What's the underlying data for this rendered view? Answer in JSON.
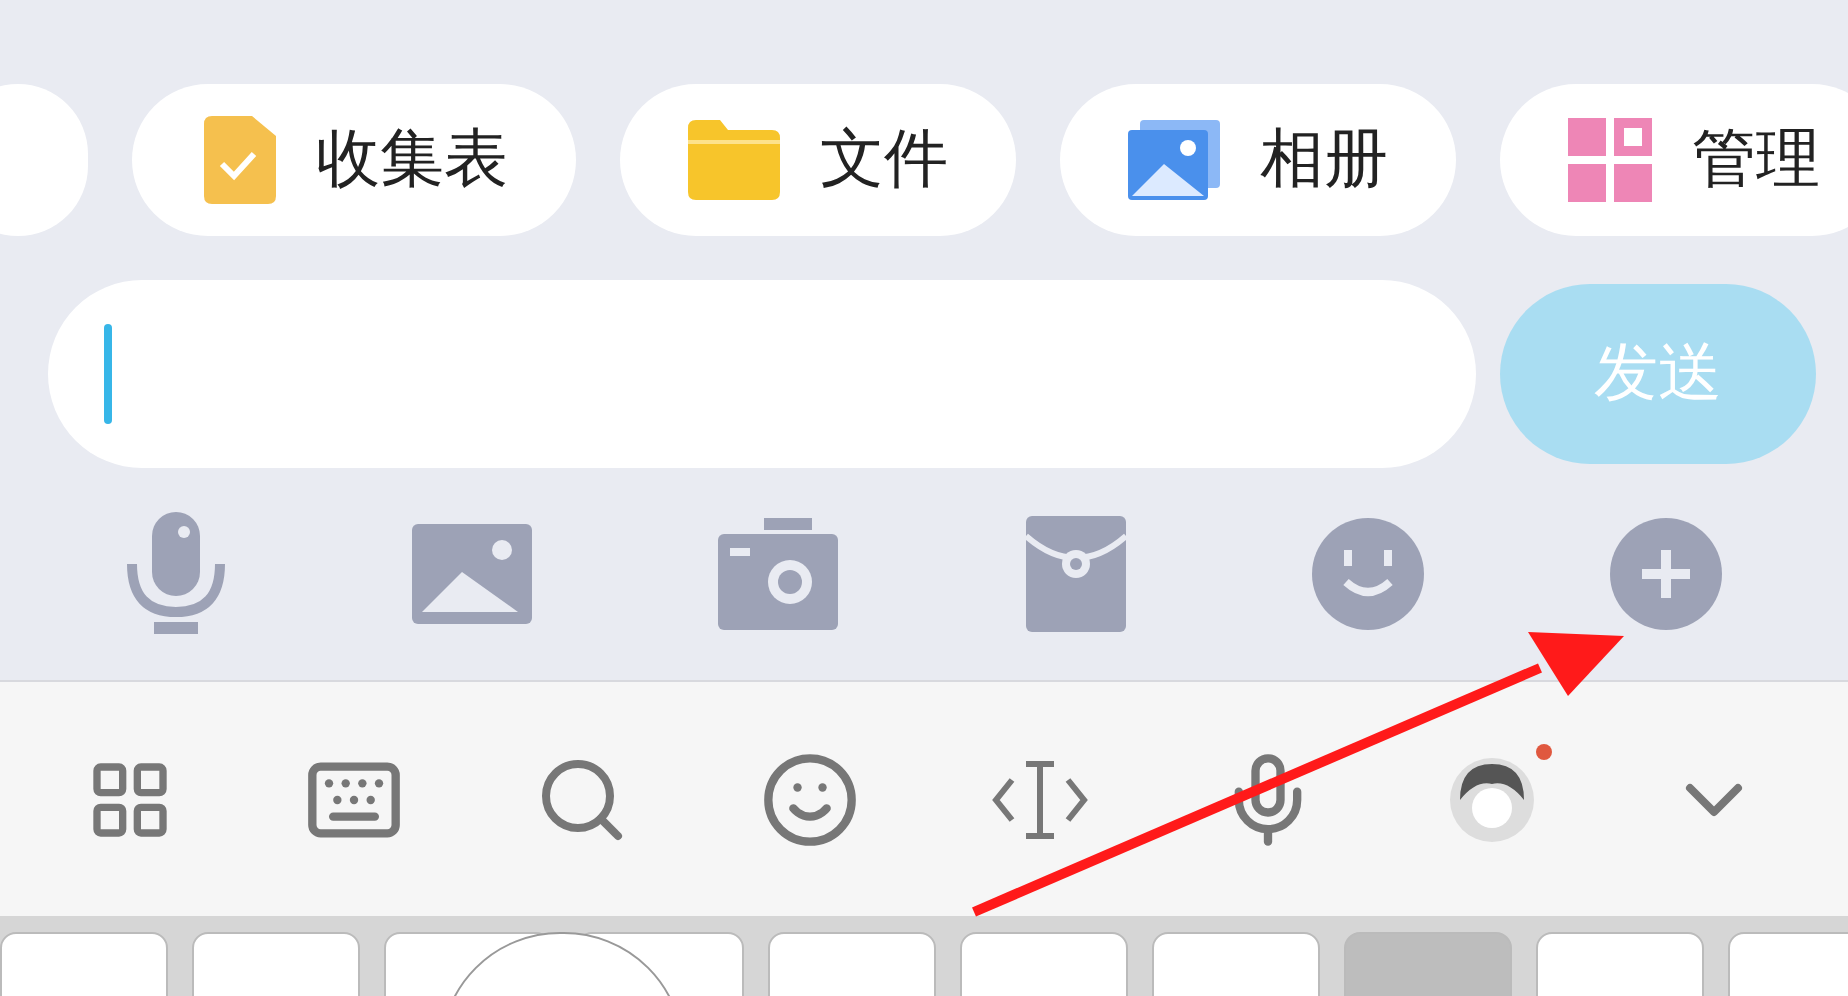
{
  "shortcut_chips": [
    {
      "kind": "form",
      "label": "收集表"
    },
    {
      "kind": "folder",
      "label": "文件"
    },
    {
      "kind": "album",
      "label": "相册"
    },
    {
      "kind": "manage",
      "label": "管理"
    }
  ],
  "message_input": {
    "focused": true
  },
  "send_button": {
    "label": "发送",
    "disabled": true
  },
  "action_icons": [
    {
      "kind": "voice"
    },
    {
      "kind": "image"
    },
    {
      "kind": "camera"
    },
    {
      "kind": "red-packet"
    },
    {
      "kind": "emoji"
    },
    {
      "kind": "plus"
    }
  ],
  "keyboard_toolbar": [
    {
      "kind": "grid"
    },
    {
      "kind": "keyboard"
    },
    {
      "kind": "search"
    },
    {
      "kind": "emoji"
    },
    {
      "kind": "cursor"
    },
    {
      "kind": "voice"
    },
    {
      "kind": "avatar",
      "badge": true
    },
    {
      "kind": "collapse"
    }
  ],
  "keys": [
    {
      "pressed": false
    },
    {
      "pressed": false
    },
    {
      "pressed": false
    },
    {
      "pressed": false
    },
    {
      "pressed": false
    },
    {
      "pressed": false
    },
    {
      "pressed": false
    },
    {
      "pressed": true
    },
    {
      "pressed": false
    },
    {
      "pressed": false
    }
  ],
  "annotation": {
    "kind": "arrow"
  }
}
